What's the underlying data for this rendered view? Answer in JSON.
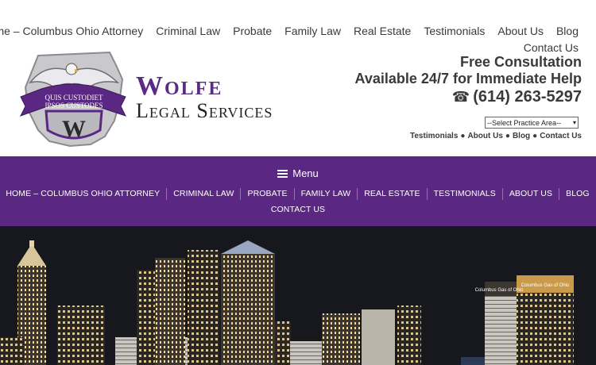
{
  "top_nav": {
    "items": [
      "Home – Columbus Ohio Attorney",
      "Criminal Law",
      "Probate",
      "Family Law",
      "Real Estate",
      "Testimonials",
      "About Us",
      "Blog"
    ],
    "second_row_item": "Contact Us"
  },
  "logo": {
    "motto_line1": "QUIS CUSTODIET",
    "motto_line2": "IPSOS CUSTODES",
    "monogram": "W",
    "name_line1": "Wolfe",
    "name_line2": "Legal Services",
    "icon": "eagle-shield-ohio-emblem"
  },
  "cta": {
    "line1": "Free Consultation",
    "line2": "Available 24/7 for Immediate Help",
    "phone": "(614) 263-5297",
    "phone_icon": "telephone-icon"
  },
  "practice_select": {
    "selected": "--Select Practice Area--"
  },
  "sub_links": [
    "Testimonials",
    "About Us",
    "Blog",
    "Contact Us"
  ],
  "menu": {
    "label": "Menu",
    "items_row1": [
      "HOME – COLUMBUS OHIO ATTORNEY",
      "CRIMINAL LAW",
      "PROBATE",
      "FAMILY LAW",
      "REAL ESTATE",
      "TESTIMONIALS",
      "ABOUT US",
      "BLOG"
    ],
    "items_row2": [
      "CONTACT US"
    ]
  },
  "hero": {
    "building_signs": [
      "Columbus Gas of Ohio",
      "Columbus Gas of Ohio"
    ]
  },
  "colors": {
    "brand_purple": "#5a2783",
    "text_dark": "#3a3a3a",
    "hero_sky": "#1b1c22"
  }
}
